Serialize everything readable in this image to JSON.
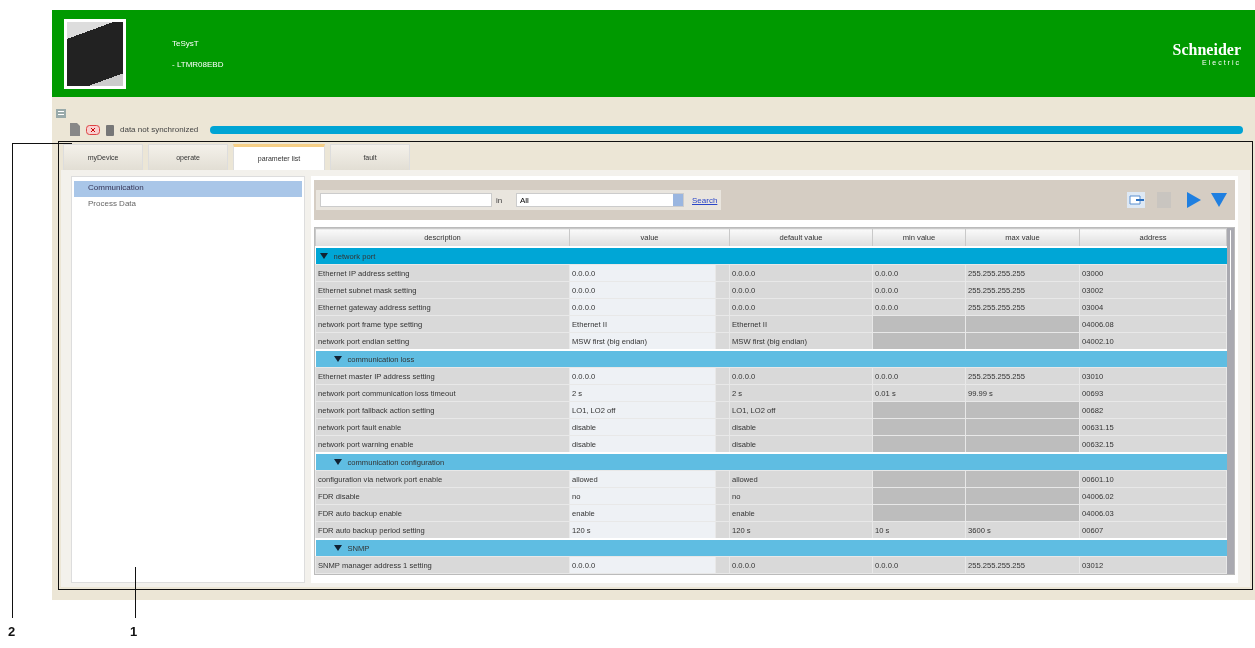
{
  "header": {
    "device_name": "TeSysT",
    "device_ref": "- LTMR08EBD",
    "logo_main": "Schneider",
    "logo_sub": "Electric"
  },
  "status": {
    "text": "data not synchronized",
    "level": 1
  },
  "tabs": [
    {
      "label": "myDevice",
      "selected": false
    },
    {
      "label": "operate",
      "selected": false
    },
    {
      "label": "parameter list",
      "selected": true
    },
    {
      "label": "fault",
      "selected": false
    }
  ],
  "tree": {
    "items": [
      {
        "label": "Communication",
        "selected": true
      },
      {
        "label": "Process Data",
        "selected": false
      }
    ]
  },
  "search": {
    "in_label": "in",
    "scope": "All",
    "button": "Search"
  },
  "table": {
    "columns": [
      "description",
      "value",
      "default value",
      "min value",
      "max value",
      "address"
    ],
    "groups": [
      {
        "title": "network port",
        "expanded": true,
        "selected": true,
        "rows": [
          [
            "Ethernet IP address setting",
            "0.0.0.0",
            "0.0.0.0",
            "0.0.0.0",
            "255.255.255.255",
            "03000"
          ],
          [
            "Ethernet subnet mask setting",
            "0.0.0.0",
            "0.0.0.0",
            "0.0.0.0",
            "255.255.255.255",
            "03002"
          ],
          [
            "Ethernet gateway address setting",
            "0.0.0.0",
            "0.0.0.0",
            "0.0.0.0",
            "255.255.255.255",
            "03004"
          ],
          [
            "network port frame type setting",
            "Ethernet II",
            "Ethernet II",
            "",
            "",
            "04006.08"
          ],
          [
            "network port endian setting",
            "MSW first (big endian)",
            "MSW first (big endian)",
            "",
            "",
            "04002.10"
          ]
        ]
      },
      {
        "title": "communication loss",
        "expanded": true,
        "selected": false,
        "rows": [
          [
            "Ethernet master IP address setting",
            "0.0.0.0",
            "0.0.0.0",
            "0.0.0.0",
            "255.255.255.255",
            "03010"
          ],
          [
            "network port communication loss timeout",
            "2 s",
            "2 s",
            "0.01 s",
            "99.99 s",
            "00693"
          ],
          [
            "network port fallback action setting",
            "LO1, LO2 off",
            "LO1, LO2 off",
            "",
            "",
            "00682"
          ],
          [
            "network port fault enable",
            "disable",
            "disable",
            "",
            "",
            "00631.15"
          ],
          [
            "network port warning enable",
            "disable",
            "disable",
            "",
            "",
            "00632.15"
          ]
        ]
      },
      {
        "title": "communication configuration",
        "expanded": true,
        "selected": false,
        "rows": [
          [
            "configuration via network port enable",
            "allowed",
            "allowed",
            "",
            "",
            "00601.10"
          ],
          [
            "FDR disable",
            "no",
            "no",
            "",
            "",
            "04006.02"
          ],
          [
            "FDR auto backup enable",
            "enable",
            "enable",
            "",
            "",
            "04006.03"
          ],
          [
            "FDR auto backup period setting",
            "120 s",
            "120 s",
            "10 s",
            "3600 s",
            "00607"
          ]
        ]
      },
      {
        "title": "SNMP",
        "expanded": true,
        "selected": false,
        "rows": [
          [
            "SNMP manager address 1 setting",
            "0.0.0.0",
            "0.0.0.0",
            "0.0.0.0",
            "255.255.255.255",
            "03012"
          ]
        ]
      }
    ]
  },
  "callouts": [
    {
      "label": "2"
    },
    {
      "label": "1"
    }
  ]
}
